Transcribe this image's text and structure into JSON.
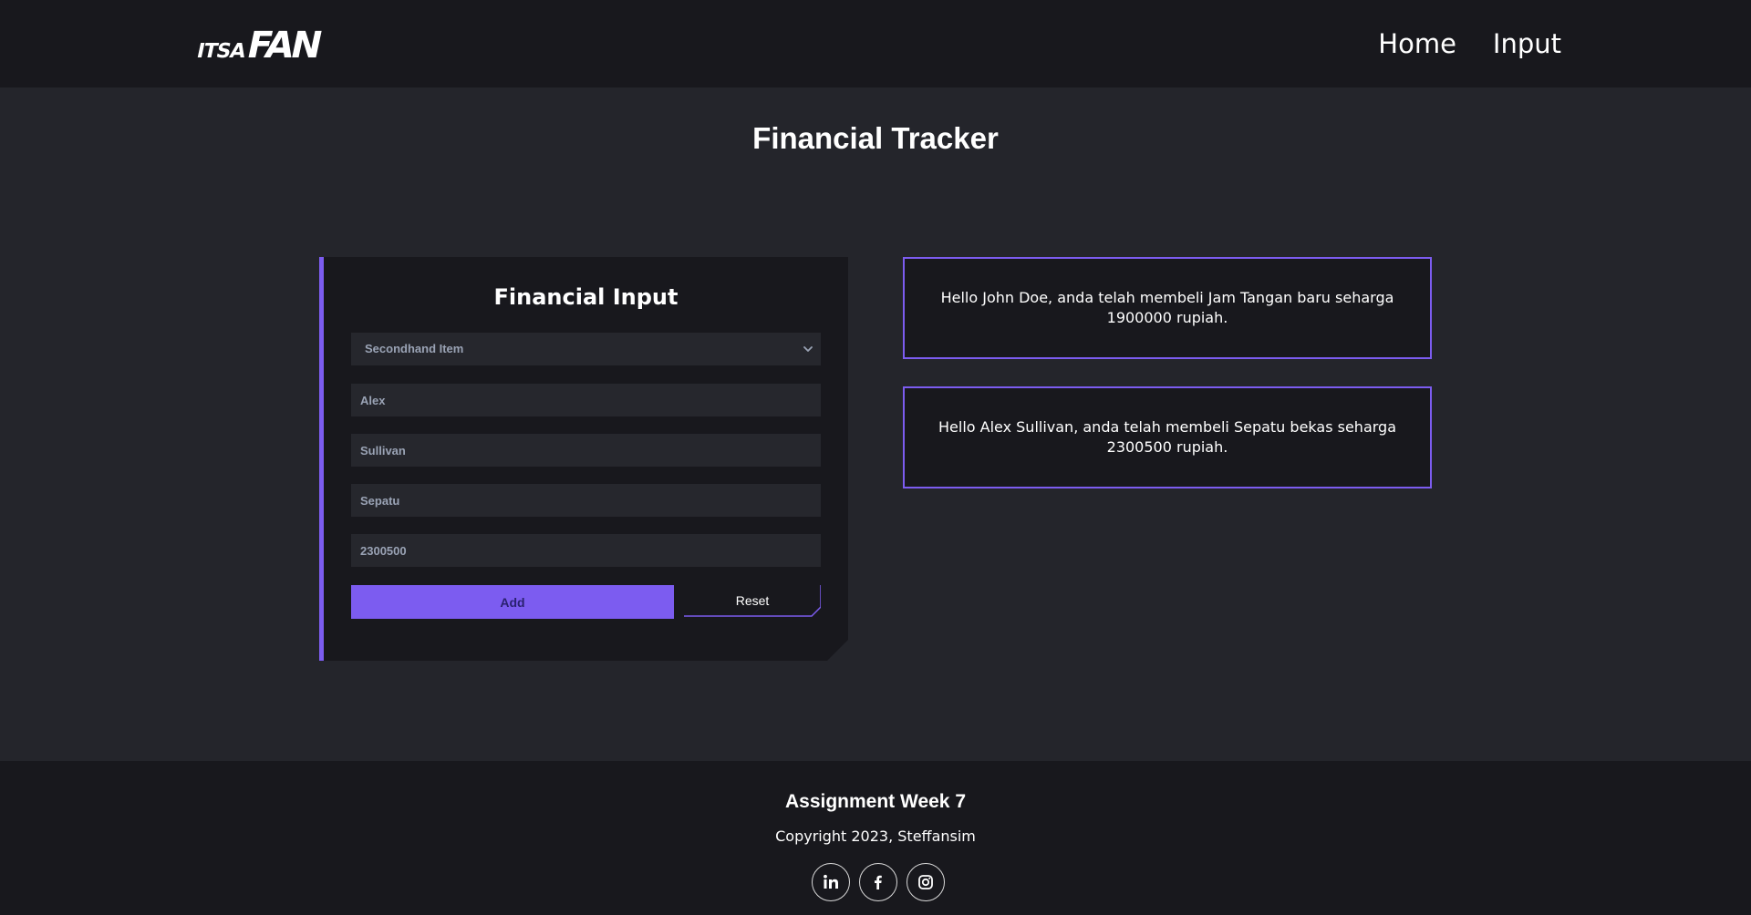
{
  "header": {
    "logo_small": "ITSA",
    "logo_big": "FAN",
    "nav": [
      "Home",
      "Input"
    ]
  },
  "page_title": "Financial Tracker",
  "form": {
    "title": "Financial Input",
    "category_selected": "Secondhand Item",
    "first_name": "Alex",
    "last_name": "Sullivan",
    "item": "Sepatu",
    "price": "2300500",
    "add_label": "Add",
    "reset_label": "Reset"
  },
  "results": [
    "Hello John Doe, anda telah membeli Jam Tangan baru seharga 1900000 rupiah.",
    "Hello Alex Sullivan, anda telah membeli Sepatu bekas seharga 2300500 rupiah."
  ],
  "footer": {
    "title": "Assignment Week 7",
    "copyright": "Copyright 2023, Steffansim",
    "socials": [
      "linkedin-icon",
      "facebook-icon",
      "instagram-icon"
    ]
  },
  "colors": {
    "accent": "#7c5cf0",
    "header_bg": "#18181d",
    "page_bg": "#24252b"
  }
}
